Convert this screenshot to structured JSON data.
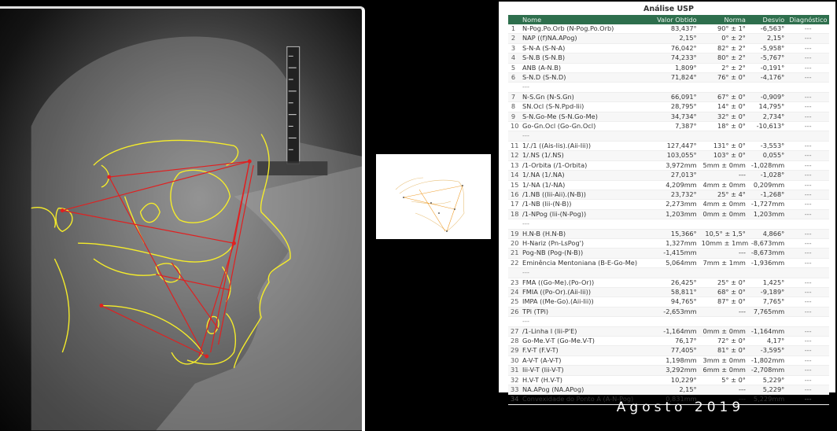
{
  "analysis": {
    "title": "Análise USP",
    "columns": {
      "num": "",
      "name": "Nome",
      "value": "Valor Obtido",
      "norma": "Norma",
      "desvio": "Desvio",
      "diag": "Diagnóstico"
    },
    "rows": [
      {
        "n": "1",
        "name": "N-Pog.Po.Orb (N-Pog.Po.Orb)",
        "value": "83,437°",
        "norma": "90° ± 1°",
        "desvio": "-6,563°",
        "diag": "---"
      },
      {
        "n": "2",
        "name": "NAP ((f)NA.APog)",
        "value": "2,15°",
        "norma": "0° ± 2°",
        "desvio": "2,15°",
        "diag": "---"
      },
      {
        "n": "3",
        "name": "S-N-A (S-N-A)",
        "value": "76,042°",
        "norma": "82° ± 2°",
        "desvio": "-5,958°",
        "diag": "---"
      },
      {
        "n": "4",
        "name": "S-N.B (S-N.B)",
        "value": "74,233°",
        "norma": "80° ± 2°",
        "desvio": "-5,767°",
        "diag": "---"
      },
      {
        "n": "5",
        "name": "ANB (A-N.B)",
        "value": "1,809°",
        "norma": "2° ± 2°",
        "desvio": "-0,191°",
        "diag": "---"
      },
      {
        "n": "6",
        "name": "S-N.D (S-N.D)",
        "value": "71,824°",
        "norma": "76° ± 0°",
        "desvio": "-4,176°",
        "diag": "---"
      },
      {
        "n": "",
        "name": "---",
        "value": "",
        "norma": "",
        "desvio": "",
        "diag": ""
      },
      {
        "n": "7",
        "name": "N-S.Gn (N-S.Gn)",
        "value": "66,091°",
        "norma": "67° ± 0°",
        "desvio": "-0,909°",
        "diag": "---"
      },
      {
        "n": "8",
        "name": "SN.Ocl (S-N.Ppd-Iii)",
        "value": "28,795°",
        "norma": "14° ± 0°",
        "desvio": "14,795°",
        "diag": "---"
      },
      {
        "n": "9",
        "name": "S-N.Go-Me (S-N.Go-Me)",
        "value": "34,734°",
        "norma": "32° ± 0°",
        "desvio": "2,734°",
        "diag": "---"
      },
      {
        "n": "10",
        "name": "Go-Gn.Ocl (Go-Gn.Ocl)",
        "value": "7,387°",
        "norma": "18° ± 0°",
        "desvio": "-10,613°",
        "diag": "---"
      },
      {
        "n": "",
        "name": "---",
        "value": "",
        "norma": "",
        "desvio": "",
        "diag": ""
      },
      {
        "n": "11",
        "name": "1/./1 ((Ais-Iis).(Aii-Iii))",
        "value": "127,447°",
        "norma": "131° ± 0°",
        "desvio": "-3,553°",
        "diag": "---"
      },
      {
        "n": "12",
        "name": "1/.NS (1/.NS)",
        "value": "103,055°",
        "norma": "103° ± 0°",
        "desvio": "0,055°",
        "diag": "---"
      },
      {
        "n": "13",
        "name": "/1-Orbita (/1-Orbita)",
        "value": "3,972mm",
        "norma": "5mm ± 0mm",
        "desvio": "-1,028mm",
        "diag": "---"
      },
      {
        "n": "14",
        "name": "1/.NA (1/.NA)",
        "value": "27,013°",
        "norma": "---",
        "desvio": "-1,028°",
        "diag": "---"
      },
      {
        "n": "15",
        "name": "1/-NA (1/-NA)",
        "value": "4,209mm",
        "norma": "4mm ± 0mm",
        "desvio": "0,209mm",
        "diag": "---"
      },
      {
        "n": "16",
        "name": "/1.NB ((Iii-Aii).(N-B))",
        "value": "23,732°",
        "norma": "25° ± 4°",
        "desvio": "-1,268°",
        "diag": "---"
      },
      {
        "n": "17",
        "name": "/1-NB (Iii-(N-B))",
        "value": "2,273mm",
        "norma": "4mm ± 0mm",
        "desvio": "-1,727mm",
        "diag": "---"
      },
      {
        "n": "18",
        "name": "/1-NPog (Iii-(N-Pog))",
        "value": "1,203mm",
        "norma": "0mm ± 0mm",
        "desvio": "1,203mm",
        "diag": "---"
      },
      {
        "n": "",
        "name": "---",
        "value": "",
        "norma": "",
        "desvio": "",
        "diag": ""
      },
      {
        "n": "19",
        "name": "H.N-B (H.N-B)",
        "value": "15,366°",
        "norma": "10,5° ± 1,5°",
        "desvio": "4,866°",
        "diag": "---"
      },
      {
        "n": "20",
        "name": "H-Nariz (Pn-LsPog')",
        "value": "1,327mm",
        "norma": "10mm ± 1mm",
        "desvio": "-8,673mm",
        "diag": "---"
      },
      {
        "n": "21",
        "name": "Pog-NB (Pog-(N-B))",
        "value": "-1,415mm",
        "norma": "---",
        "desvio": "-8,673mm",
        "diag": "---"
      },
      {
        "n": "22",
        "name": "Eminência Mentoniana (B-E-Go-Me)",
        "value": "5,064mm",
        "norma": "7mm ± 1mm",
        "desvio": "-1,936mm",
        "diag": "---"
      },
      {
        "n": "",
        "name": "---",
        "value": "",
        "norma": "",
        "desvio": "",
        "diag": ""
      },
      {
        "n": "23",
        "name": "FMA ((Go-Me).(Po-Or))",
        "value": "26,425°",
        "norma": "25° ± 0°",
        "desvio": "1,425°",
        "diag": "---"
      },
      {
        "n": "24",
        "name": "FMIA ((Po-Or).(Aii-Iii))",
        "value": "58,811°",
        "norma": "68° ± 0°",
        "desvio": "-9,189°",
        "diag": "---"
      },
      {
        "n": "25",
        "name": "IMPA ((Me-Go).(Aii-Iii))",
        "value": "94,765°",
        "norma": "87° ± 0°",
        "desvio": "7,765°",
        "diag": "---"
      },
      {
        "n": "26",
        "name": "TPi (TPi)",
        "value": "-2,653mm",
        "norma": "---",
        "desvio": "7,765mm",
        "diag": "---"
      },
      {
        "n": "",
        "name": "---",
        "value": "",
        "norma": "",
        "desvio": "",
        "diag": ""
      },
      {
        "n": "27",
        "name": "/1-Linha I (Iii-P'E)",
        "value": "-1,164mm",
        "norma": "0mm ± 0mm",
        "desvio": "-1,164mm",
        "diag": "---"
      },
      {
        "n": "28",
        "name": "Go-Me.V-T (Go-Me.V-T)",
        "value": "76,17°",
        "norma": "72° ± 0°",
        "desvio": "4,17°",
        "diag": "---"
      },
      {
        "n": "29",
        "name": "F.V-T (F.V-T)",
        "value": "77,405°",
        "norma": "81° ± 0°",
        "desvio": "-3,595°",
        "diag": "---"
      },
      {
        "n": "30",
        "name": "A-V-T (A-V-T)",
        "value": "1,198mm",
        "norma": "3mm ± 0mm",
        "desvio": "-1,802mm",
        "diag": "---"
      },
      {
        "n": "31",
        "name": "Iii-V-T (Iii-V-T)",
        "value": "3,292mm",
        "norma": "6mm ± 0mm",
        "desvio": "-2,708mm",
        "diag": "---"
      },
      {
        "n": "32",
        "name": "H.V-T (H.V-T)",
        "value": "10,229°",
        "norma": "5° ± 0°",
        "desvio": "5,229°",
        "diag": "---"
      },
      {
        "n": "33",
        "name": "NA.APog (NA.APog)",
        "value": "2,15°",
        "norma": "---",
        "desvio": "5,229°",
        "diag": "---"
      },
      {
        "n": "34",
        "name": "Convexidade do Ponto A (A-N-Pog)",
        "value": "0,831mm",
        "norma": "---",
        "desvio": "5,229mm",
        "diag": "---"
      }
    ]
  },
  "caption": "Agosto 2019",
  "colors": {
    "header_bg": "#2e6f4d",
    "trace_yellow": "#f5ec2a",
    "trace_red": "#e02020"
  }
}
